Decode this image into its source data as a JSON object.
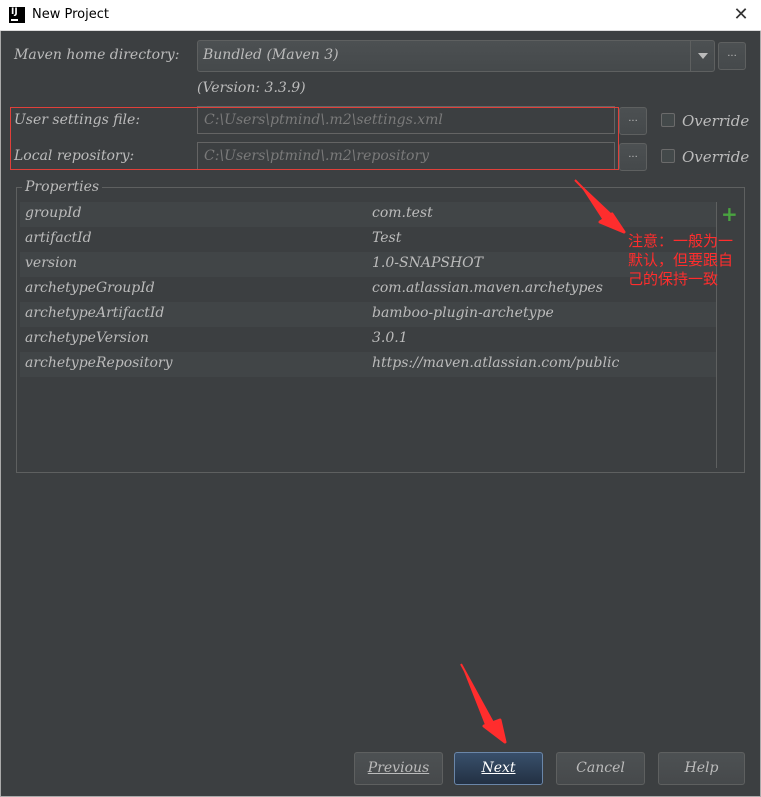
{
  "window": {
    "title": "New Project"
  },
  "maven": {
    "home_label": "Maven home directory:",
    "home_value": "Bundled (Maven 3)",
    "version": "(Version: 3.3.9)",
    "user_settings_label": "User settings file:",
    "user_settings_value": "C:\\Users\\ptmind\\.m2\\settings.xml",
    "local_repo_label": "Local repository:",
    "local_repo_value": "C:\\Users\\ptmind\\.m2\\repository",
    "override_label": "Override",
    "browse_label": "..."
  },
  "properties": {
    "title": "Properties",
    "rows": [
      {
        "key": "groupId",
        "value": "com.test"
      },
      {
        "key": "artifactId",
        "value": "Test"
      },
      {
        "key": "version",
        "value": "1.0-SNAPSHOT"
      },
      {
        "key": "archetypeGroupId",
        "value": "com.atlassian.maven.archetypes"
      },
      {
        "key": "archetypeArtifactId",
        "value": "bamboo-plugin-archetype"
      },
      {
        "key": "archetypeVersion",
        "value": "3.0.1"
      },
      {
        "key": "archetypeRepository",
        "value": "https://maven.atlassian.com/public"
      }
    ],
    "add_label": "+"
  },
  "annotation": {
    "text": "注意：一般为一默认，但要跟自己的保持一致"
  },
  "buttons": {
    "previous": "Previous",
    "next": "Next",
    "cancel": "Cancel",
    "help": "Help"
  },
  "colors": {
    "annotation": "#ff2d2d",
    "accent_button": "#6a86a8",
    "add_icon": "#4aa340"
  }
}
